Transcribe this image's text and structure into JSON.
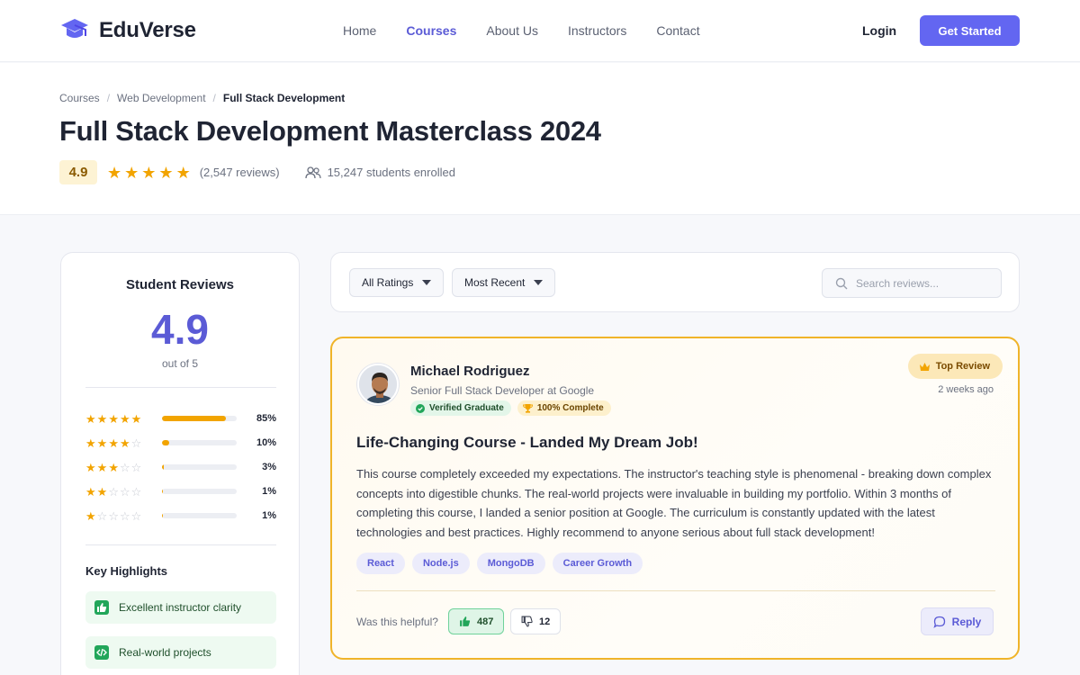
{
  "nav": {
    "brand": "EduVerse",
    "links": [
      "Home",
      "Courses",
      "About Us",
      "Instructors",
      "Contact"
    ],
    "active_link": "Courses",
    "login": "Login",
    "cta": "Get Started"
  },
  "breadcrumb": [
    "Courses",
    "Web Development",
    "Full Stack Development"
  ],
  "course": {
    "title": "Full Stack Development Masterclass 2024",
    "rating": "4.9",
    "stars": 5,
    "reviews": "(2,547 reviews)",
    "students": "15,247 students enrolled"
  },
  "summary": {
    "title": "Student Reviews",
    "score": "4.9",
    "out_of": "out of 5",
    "distribution": [
      {
        "stars": 5,
        "percent": 85,
        "label": "85%"
      },
      {
        "stars": 4,
        "percent": 10,
        "label": "10%"
      },
      {
        "stars": 3,
        "percent": 3,
        "label": "3%"
      },
      {
        "stars": 2,
        "percent": 1,
        "label": "1%"
      },
      {
        "stars": 1,
        "percent": 1,
        "label": "1%"
      }
    ],
    "highlights_title": "Key Highlights",
    "highlights": [
      {
        "label": "Excellent instructor clarity",
        "icon": "thumbs-up-icon"
      },
      {
        "label": "Real-world projects",
        "icon": "code-icon"
      }
    ]
  },
  "filters": {
    "rating": "All Ratings",
    "sort": "Most Recent",
    "search_placeholder": "Search reviews..."
  },
  "review": {
    "name": "Michael Rodriguez",
    "role": "Senior Full Stack Developer at Google",
    "badges": [
      "Verified Graduate",
      "100% Complete"
    ],
    "top_label": "Top Review",
    "date": "2 weeks ago",
    "title": "Life-Changing Course - Landed My Dream Job!",
    "body": "This course completely exceeded my expectations. The instructor's teaching style is phenomenal - breaking down complex concepts into digestible chunks. The real-world projects were invaluable in building my portfolio. Within 3 months of completing this course, I landed a senior position at Google. The curriculum is constantly updated with the latest technologies and best practices. Highly recommend to anyone serious about full stack development!",
    "tags": [
      "React",
      "Node.js",
      "MongoDB",
      "Career Growth"
    ],
    "helpful_label": "Was this helpful?",
    "helpful_count": "487",
    "not_helpful_count": "12",
    "reply": "Reply"
  },
  "colors": {
    "accent": "#6366f1",
    "star": "#f2a400",
    "top_review_border": "#f0b429",
    "highlight_green": "#22a65a"
  }
}
